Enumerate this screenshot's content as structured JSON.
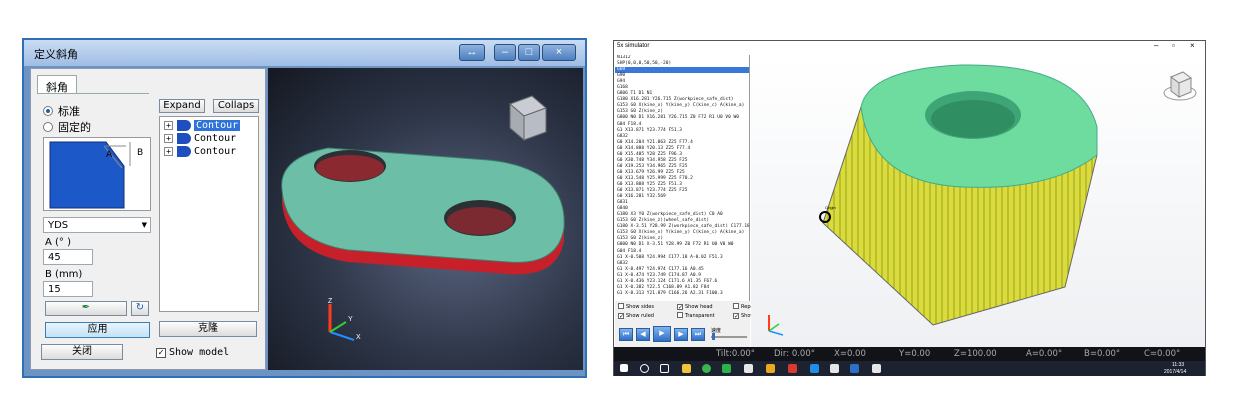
{
  "left_window": {
    "title": "定义斜角",
    "tab": "斜角",
    "radio_standard": "标准",
    "radio_fixed": "固定的",
    "diagram_a": "A",
    "diagram_b": "B",
    "dropdown": "YDS",
    "label_a": "A (° )",
    "value_a": "45",
    "label_b": "B (mm)",
    "value_b": "15",
    "apply": "应用",
    "clone": "克隆",
    "close": "关闭",
    "expand": "Expand",
    "collapse": "Collaps",
    "tree": [
      "Contour",
      "Contour",
      "Contour"
    ],
    "show_model": "Show model",
    "axis_z": "Z",
    "axis_y": "Y",
    "axis_x": "X"
  },
  "right_window": {
    "title": "5x simulator",
    "code_lines": [
      "N1312",
      "SHP(0,0,0,50,50,-20)",
      "G69",
      "G90",
      "G94",
      "G168",
      "G806 T1 D1 N1",
      "G180 X16.281 Y26.715 Z(workpiece_safe_dist)",
      "G153 G0 X(kine_x) Y(kine_y) C(kine_c) A(kine_a)",
      "G153 G0 Z(kine_z)",
      "G800 N0 D1 X16.281 Y26.715 Z0 F72 R1 U0 V0 W0",
      "G04 F18.4",
      "G1 X13.871 Y23.774 F51.3",
      "G832",
      "G0 X14.204 Y21.063 Z25 F77.4",
      "G0 X14.888 Y20.13 Z25 F77.4",
      "G0 X15.485 Y28 Z25 F96.3",
      "G0 X30.748 Y34.958 Z25 F25",
      "G0 X19.253 Y34.965 Z25 F25",
      "G0 X13.679 Y26.99 Z25 F25",
      "G0 X13.548 Y25.999 Z25 F70.2",
      "G0 X13.808 Y25 Z25 F51.3",
      "G0 X13.871 Y23.774 Z25 F25",
      "G0 X16.281 Y32.569",
      "G831",
      "G840",
      "G180 X3 Y0 Z(workpiece_safe_dist) C0 A0",
      "G153 G0 Z(kine_z)(wheel_safe_dist)",
      "G180 X-3.51 Y28.99 Z(workpiece_safe_dist) C177.18 A0.45",
      "G153 G0 X(kine_x) Y(kine_y) C(kine_c) A(kine_a)",
      "G153 G0 Z(kine_z)",
      "G800 N0 D1 X-3.51 Y28.99 Z0 F72 R1 U0 V0 W0",
      "G04 F18.4",
      "G1 X-0.508 Y24.994 C177.18 A-0.02 F51.3",
      "G832",
      "G1 X-0.497 Y24.974 C177.16 A0.45",
      "G1 X-0.474 Y23.749 C174.87 A0.9",
      "G1 X-0.436 Y23.124 C171.6 A1.35 F67.6",
      "G1 X-0.382 Y22.5 C168.89 A1.82 F84",
      "G1 X-0.313 Y21.879 C166.26 A2.31 F100.3"
    ],
    "show_sides": "Show sides",
    "show_head": "Show head",
    "repeat": "Repea",
    "show_ruled": "Show ruled",
    "transparent": "Transparent",
    "show": "Show",
    "speed": "速度",
    "origin": "Origin",
    "status": {
      "tilt": "Tilt:0.00°",
      "dir": "Dir: 0.00°",
      "x": "X=0.00",
      "y": "Y=0.00",
      "z": "Z=100.00",
      "a": "A=0.00°",
      "b": "B=0.00°",
      "c": "C=0.00°"
    },
    "clock_time": "11:33",
    "clock_date": "2017/4/14"
  }
}
